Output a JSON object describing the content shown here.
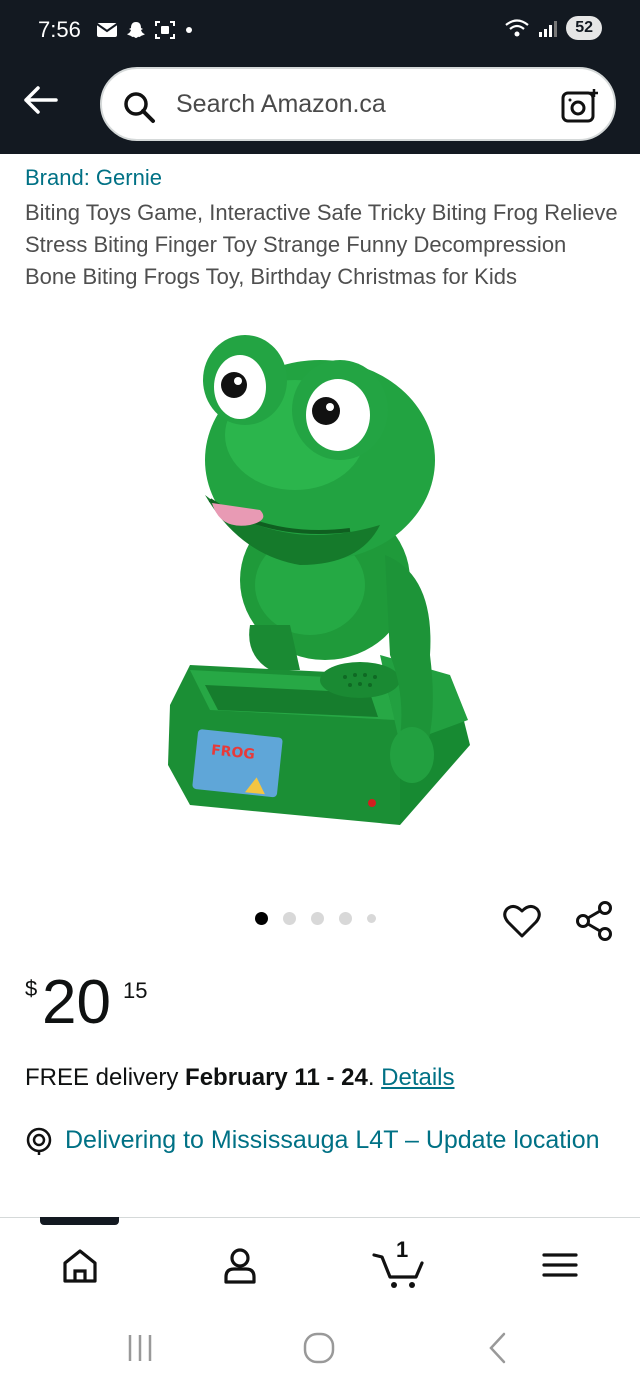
{
  "status_bar": {
    "time": "7:56",
    "battery": "52",
    "notification_icons": [
      "mail-icon",
      "snapchat-icon",
      "screenshot-icon",
      "dot-icon"
    ],
    "system_icons": [
      "wifi-icon",
      "signal-icon"
    ]
  },
  "search": {
    "placeholder": "Search Amazon.ca"
  },
  "product": {
    "brand": "Brand: Gernie",
    "title": "Biting Toys Game, Interactive Safe Tricky Biting Frog Relieve Stress Biting Finger Toy Strange Funny Decompression Bone Biting Frogs Toy, Birthday Christmas for Kids",
    "image_alt": "Green frog biting toy game",
    "image_label_top": "FROG",
    "carousel": {
      "count": 5,
      "active": 1
    },
    "price": {
      "currency": "$",
      "whole": "20",
      "fraction": "15"
    }
  },
  "delivery": {
    "prefix": "FREE delivery ",
    "dates": "February 11 - 24",
    "suffix": ". ",
    "details_link": "Details"
  },
  "location": {
    "text": "Delivering to Mississauga L4T – Update location"
  },
  "bottom_nav": {
    "items": [
      "home-icon",
      "account-icon",
      "cart-icon",
      "menu-icon"
    ],
    "cart_count": "1"
  },
  "colors": {
    "header_bg": "#131921",
    "link": "#007185",
    "frog_green": "#1e9a3c"
  }
}
